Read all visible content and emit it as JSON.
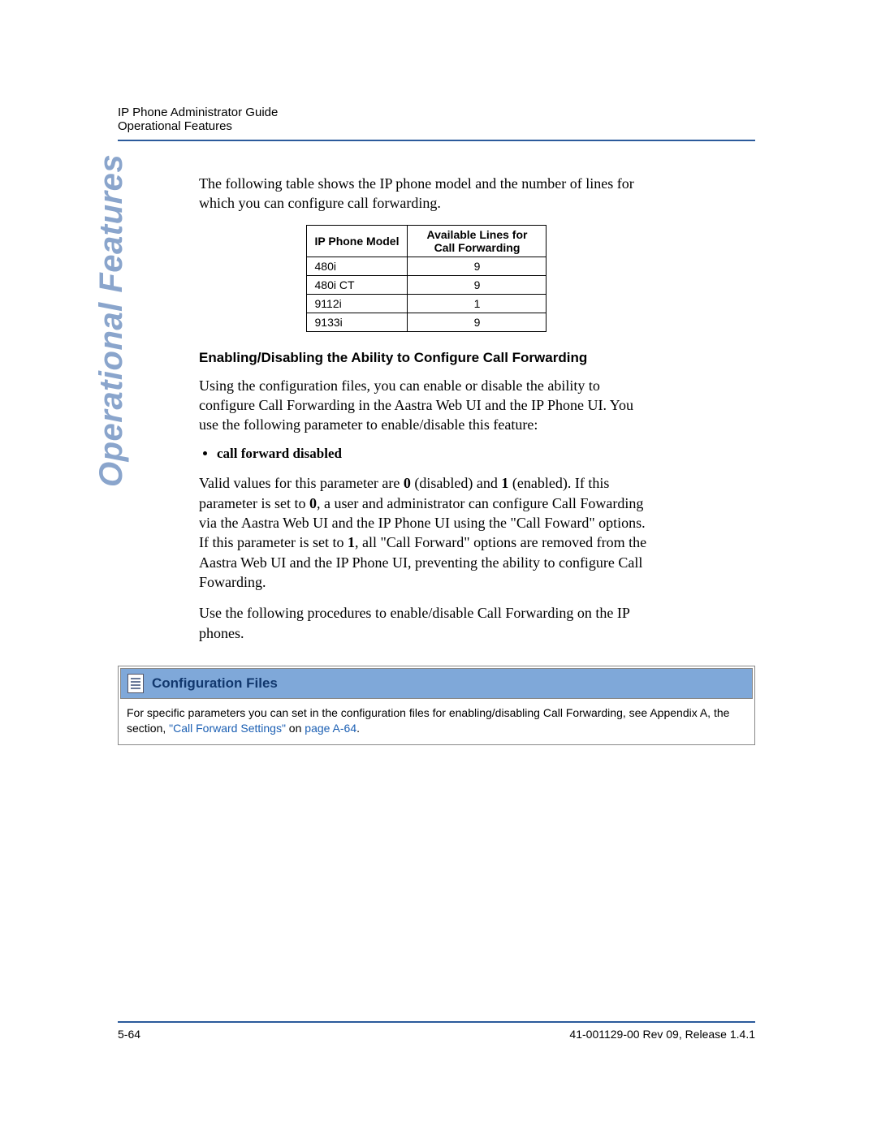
{
  "header": {
    "line1": "IP Phone Administrator Guide",
    "line2": "Operational Features"
  },
  "side_label": "Operational Features",
  "intro_para": "The following table shows the IP phone model and the number of lines for which you can configure call forwarding.",
  "table": {
    "headers": [
      "IP Phone Model",
      "Available Lines for Call Forwarding"
    ],
    "rows": [
      {
        "model": "480i",
        "lines": "9"
      },
      {
        "model": "480i CT",
        "lines": "9"
      },
      {
        "model": "9112i",
        "lines": "1"
      },
      {
        "model": "9133i",
        "lines": "9"
      }
    ]
  },
  "subhead": "Enabling/Disabling the Ability to Configure Call Forwarding",
  "para2": "Using the configuration files, you can enable or disable the ability to configure Call Forwarding in the Aastra Web UI and the IP Phone UI. You use the following parameter to enable/disable this feature:",
  "bullet": "call forward disabled",
  "para3_parts": {
    "a": "Valid values for this parameter are ",
    "b0": "0",
    "c": " (disabled) and ",
    "b1": "1",
    "d": " (enabled). If this parameter is set to ",
    "b0b": "0",
    "e": ", a user and administrator can configure Call Fowarding via the Aastra Web UI and the IP Phone UI using the \"Call Foward\" options. If this parameter is set to ",
    "b1b": "1",
    "f": ", all \"Call Forward\" options are removed from the Aastra Web UI and the IP Phone UI, preventing the ability to configure Call Fowarding."
  },
  "para4": "Use the following procedures to enable/disable Call Forwarding on the IP phones.",
  "config_box": {
    "title": "Configuration Files",
    "body_a": "For specific parameters you can set in the configuration files for enabling/disabling Call Forwarding, see Appendix A, the section, ",
    "link1": "\"Call Forward Settings\"",
    "body_b": " on ",
    "link2": "page A-64",
    "body_c": "."
  },
  "footer": {
    "left": "5-64",
    "right": "41-001129-00 Rev 09, Release 1.4.1"
  }
}
